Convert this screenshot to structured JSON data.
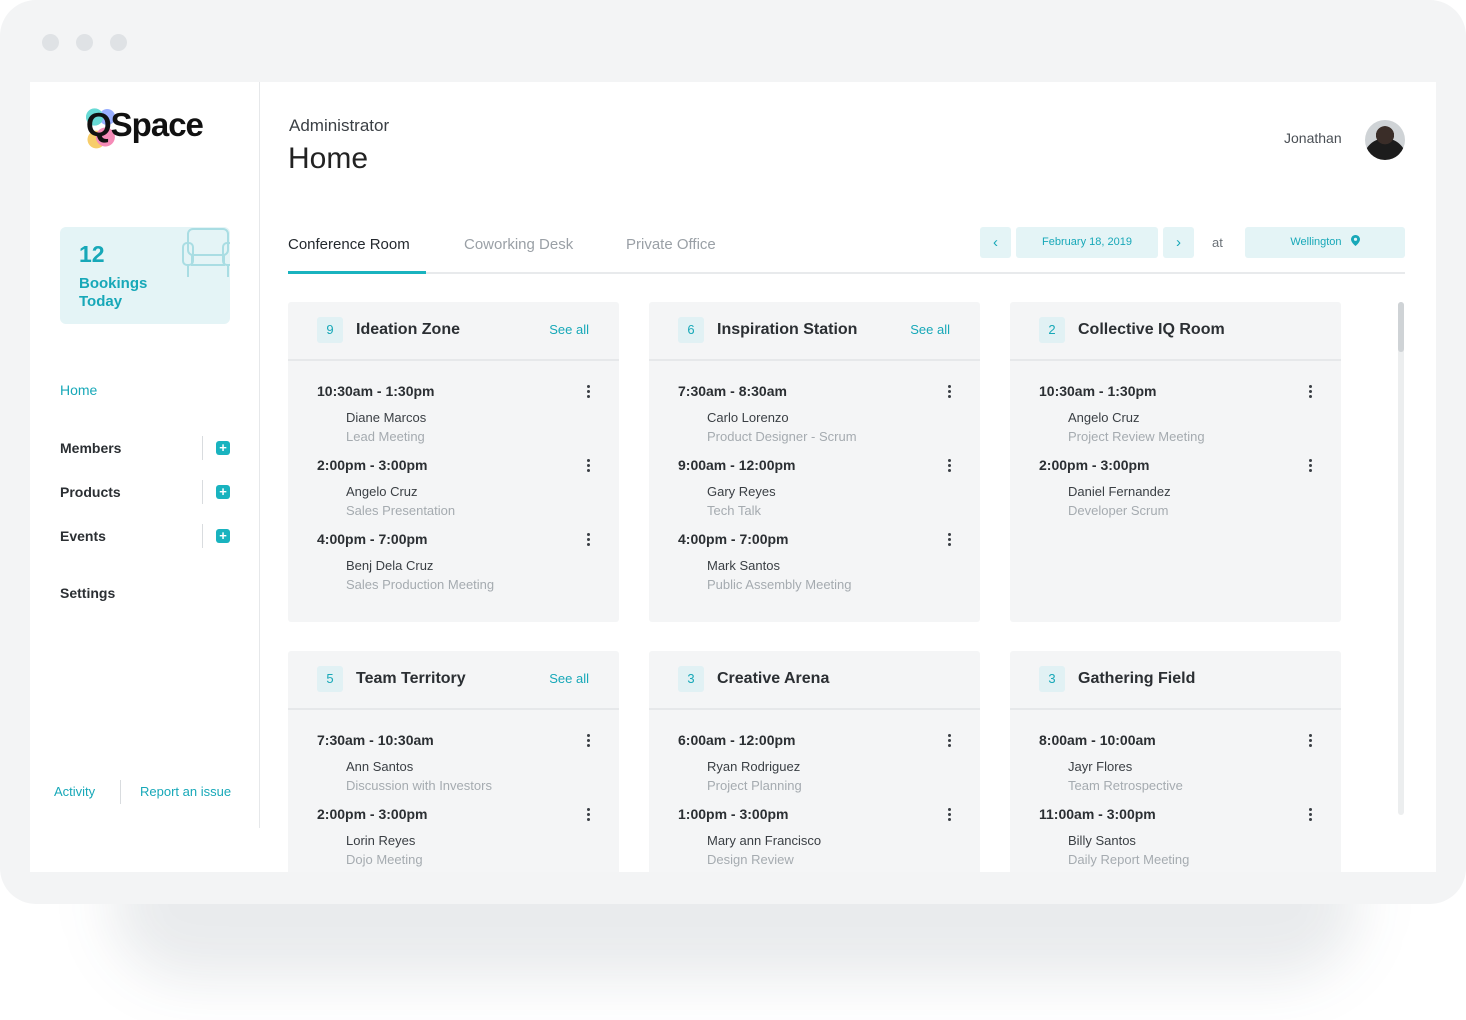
{
  "app": {
    "logo_text": "QSpace"
  },
  "stats": {
    "count": "12",
    "label": "Bookings Today"
  },
  "nav": {
    "home": "Home",
    "members": "Members",
    "products": "Products",
    "events": "Events",
    "settings": "Settings",
    "plus": "+"
  },
  "footer": {
    "activity": "Activity",
    "report": "Report an issue"
  },
  "header": {
    "role": "Administrator",
    "title": "Home",
    "user_name": "Jonathan"
  },
  "tabs": [
    "Conference Room",
    "Coworking Desk",
    "Private Office"
  ],
  "controls": {
    "prev": "‹",
    "next": "›",
    "date": "February 18, 2019",
    "at": "at",
    "location": "Wellington"
  },
  "rooms": [
    {
      "count": "9",
      "name": "Ideation Zone",
      "see_all": "See all",
      "bookings": [
        {
          "time": "10:30am - 1:30pm",
          "person": "Diane Marcos",
          "desc": "Lead Meeting"
        },
        {
          "time": "2:00pm - 3:00pm",
          "person": "Angelo Cruz",
          "desc": "Sales Presentation"
        },
        {
          "time": "4:00pm - 7:00pm",
          "person": "Benj Dela Cruz",
          "desc": "Sales Production Meeting"
        }
      ]
    },
    {
      "count": "6",
      "name": "Inspiration Station",
      "see_all": "See all",
      "bookings": [
        {
          "time": "7:30am - 8:30am",
          "person": "Carlo Lorenzo",
          "desc": "Product Designer - Scrum"
        },
        {
          "time": "9:00am - 12:00pm",
          "person": "Gary Reyes",
          "desc": "Tech Talk"
        },
        {
          "time": "4:00pm - 7:00pm",
          "person": "Mark Santos",
          "desc": "Public Assembly Meeting"
        }
      ]
    },
    {
      "count": "2",
      "name": "Collective IQ Room",
      "see_all": "",
      "bookings": [
        {
          "time": "10:30am - 1:30pm",
          "person": "Angelo Cruz",
          "desc": "Project Review Meeting"
        },
        {
          "time": "2:00pm - 3:00pm",
          "person": "Daniel Fernandez",
          "desc": "Developer Scrum"
        }
      ]
    },
    {
      "count": "5",
      "name": "Team Territory",
      "see_all": "See all",
      "bookings": [
        {
          "time": "7:30am - 10:30am",
          "person": "Ann Santos",
          "desc": "Discussion with Investors"
        },
        {
          "time": "2:00pm - 3:00pm",
          "person": "Lorin Reyes",
          "desc": "Dojo Meeting"
        }
      ]
    },
    {
      "count": "3",
      "name": "Creative Arena",
      "see_all": "",
      "bookings": [
        {
          "time": "6:00am - 12:00pm",
          "person": "Ryan Rodriguez",
          "desc": "Project Planning"
        },
        {
          "time": "1:00pm - 3:00pm",
          "person": "Mary ann Francisco",
          "desc": "Design Review"
        }
      ]
    },
    {
      "count": "3",
      "name": "Gathering Field",
      "see_all": "",
      "bookings": [
        {
          "time": "8:00am - 10:00am",
          "person": "Jayr Flores",
          "desc": "Team Retrospective"
        },
        {
          "time": "11:00am - 3:00pm",
          "person": "Billy Santos",
          "desc": "Daily Report Meeting"
        }
      ]
    }
  ],
  "colors": {
    "accent": "#17a8b8",
    "accent_light": "#e4f4f6",
    "card_bg": "#f4f5f6"
  }
}
